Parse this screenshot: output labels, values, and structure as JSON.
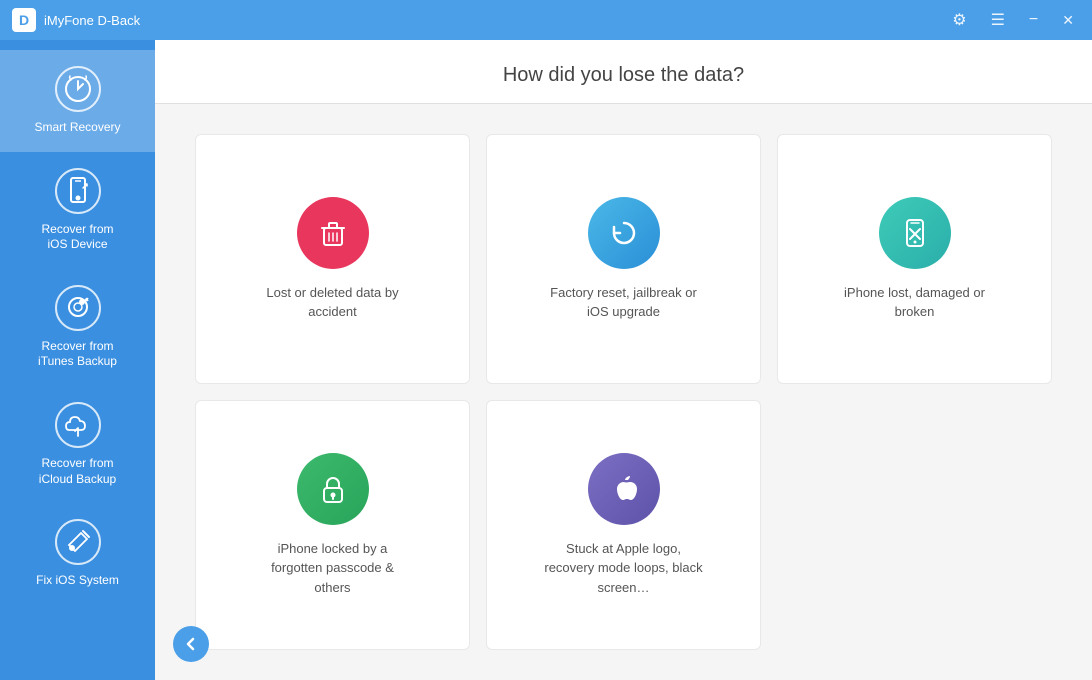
{
  "titleBar": {
    "logo": "D",
    "appName": "iMyFone D-Back",
    "settingsIcon": "⚙",
    "menuIcon": "☰",
    "minimizeIcon": "−",
    "closeIcon": "✕"
  },
  "sidebar": {
    "items": [
      {
        "id": "smart-recovery",
        "label": "Smart Recovery",
        "icon": "⚡",
        "active": true
      },
      {
        "id": "ios-device",
        "label": "Recover from\niOS Device",
        "icon": "📱",
        "active": false
      },
      {
        "id": "itunes-backup",
        "label": "Recover from\niTunes Backup",
        "icon": "🎵",
        "active": false
      },
      {
        "id": "icloud-backup",
        "label": "Recover from\niCloud Backup",
        "icon": "☁",
        "active": false
      },
      {
        "id": "fix-ios",
        "label": "Fix iOS System",
        "icon": "🔧",
        "active": false
      }
    ]
  },
  "content": {
    "title": "How did you lose the data?",
    "options": [
      {
        "id": "deleted-accident",
        "label": "Lost or deleted data by\naccident",
        "iconColor": "pink",
        "iconType": "trash"
      },
      {
        "id": "factory-reset",
        "label": "Factory reset, jailbreak or\niOS upgrade",
        "iconColor": "blue",
        "iconType": "reset"
      },
      {
        "id": "lost-damaged",
        "label": "iPhone lost, damaged or\nbroken",
        "iconColor": "teal",
        "iconType": "phone"
      },
      {
        "id": "locked-passcode",
        "label": "iPhone locked by a\nforgotten passcode &\nothers",
        "iconColor": "green",
        "iconType": "lock"
      },
      {
        "id": "apple-logo",
        "label": "Stuck at Apple logo,\nrecovery mode loops, black\nscreen…",
        "iconColor": "purple",
        "iconType": "apple"
      }
    ],
    "backButtonLabel": "←"
  }
}
